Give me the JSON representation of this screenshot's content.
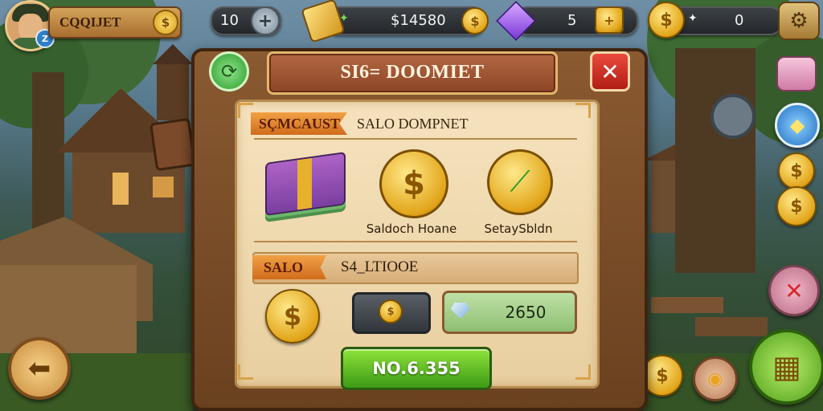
{
  "player": {
    "name": "CQQIJET",
    "level_badge": "Z",
    "name_coin_symbol": "$"
  },
  "hud": {
    "energy_value": "10",
    "energy_plus": "+",
    "gold_icon_mark": "✦",
    "gold_value": "$14580",
    "gold_coin_symbol": "$",
    "gem_value": "5",
    "gem_action_symbol": "+",
    "coin_symbol": "$",
    "coin_star": "✦",
    "coin_value": "0",
    "gear_symbol": "⚙"
  },
  "dialog": {
    "title": "SI6= DOOMIET",
    "close_symbol": "✕",
    "refresh_symbol": "⟳",
    "section1": {
      "ribbon": "SÇMCAUST",
      "title": "SALO DOMPNET",
      "items": [
        {
          "icon": "cash-stack-icon",
          "label": ""
        },
        {
          "icon": "dollar-coin-icon",
          "symbol": "$",
          "label": "Saldoch Hoane"
        },
        {
          "icon": "leaf-coin-icon",
          "symbol": "⟋",
          "label": "SetaySbldn"
        }
      ]
    },
    "section2": {
      "ribbon": "SALO",
      "title": "S4_LTIOOE",
      "big_coin_symbol": "$",
      "slot_coin_symbol": "$",
      "price": "2650"
    },
    "buy_button": "NO.6.355"
  },
  "side": {
    "back_symbol": "⬅",
    "blue_symbol": "◆",
    "pink_symbol": "✕",
    "green_symbol": "▦",
    "bag_symbol": "◉",
    "coin_symbol": "$"
  }
}
